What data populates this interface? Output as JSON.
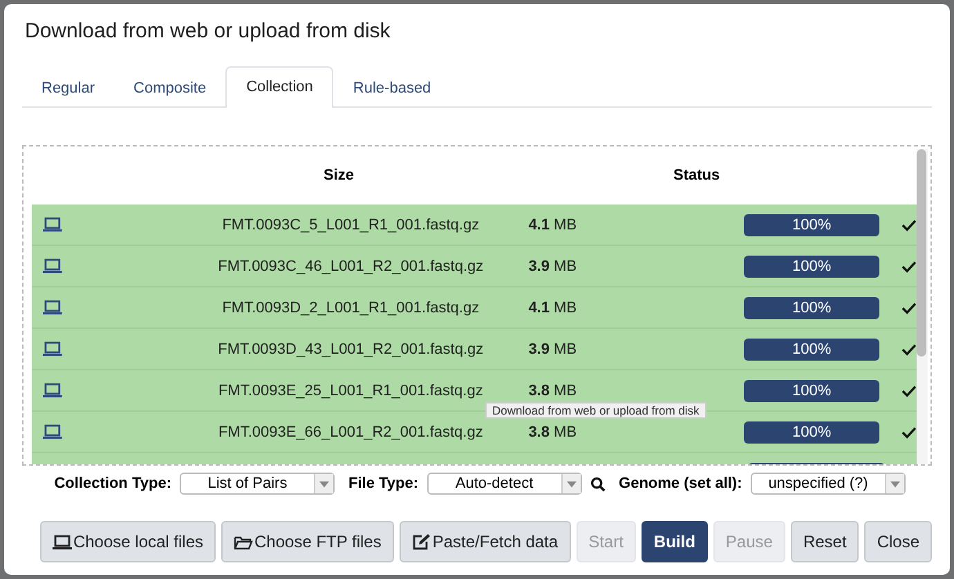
{
  "dialog": {
    "title": "Download from web or upload from disk"
  },
  "tabs": [
    {
      "label": "Regular",
      "selected": false
    },
    {
      "label": "Composite",
      "selected": false
    },
    {
      "label": "Collection",
      "selected": true
    },
    {
      "label": "Rule-based",
      "selected": false
    }
  ],
  "table": {
    "columns": [
      "Size",
      "Status"
    ],
    "rows": [
      {
        "name": "FMT.0093C_5_L001_R1_001.fastq.gz",
        "size": "**4.1** MB",
        "level": 1,
        "progress": "100%",
        "done": true
      },
      {
        "name": "FMT.0093C_46_L001_R2_001.fastq.gz",
        "size": "**3.9** MB",
        "level": 1,
        "progress": "100%",
        "done": true
      },
      {
        "name": "FMT.0093D_2_L001_R1_001.fastq.gz",
        "size": "**4.1** MB",
        "level": 1,
        "progress": "100%",
        "done": true
      },
      {
        "name": "FMT.0093D_43_L001_R2_001.fastq.gz",
        "size": "**3.9** MB",
        "level": 1,
        "progress": "100%",
        "done": true
      },
      {
        "name": "FMT.0093E_25_L001_R1_001.fastq.gz",
        "size": "**3.8** MB",
        "level": 1,
        "progress": "100%",
        "done": true
      },
      {
        "name": "FMT.0093E_66_L001_R2_001.fastq.gz",
        "size": "**3.8** MB",
        "level": 1,
        "progress": "100%",
        "done": true
      }
    ]
  },
  "tooltip": "Download from web or upload from disk",
  "settings": [
    {
      "label": "Collection Type:",
      "value": "List of Pairs",
      "kind": "plain"
    },
    {
      "label": "File Type:",
      "value": "Auto-detect",
      "kind": "search"
    },
    {
      "label": "Genome (set all):",
      "value": "unspecified (?)",
      "kind": "plain"
    }
  ],
  "buttons": [
    {
      "label": "Choose local files",
      "kind": "laptop",
      "disabled": false,
      "primary": false
    },
    {
      "label": "Choose FTP files",
      "kind": "folder",
      "disabled": false,
      "primary": false
    },
    {
      "label": "Paste/Fetch data",
      "kind": "edit",
      "disabled": false,
      "primary": false
    },
    {
      "label": "Start",
      "kind": "text",
      "disabled": true,
      "primary": false
    },
    {
      "label": "Build",
      "kind": "text",
      "disabled": false,
      "primary": true
    },
    {
      "label": "Pause",
      "kind": "text",
      "disabled": true,
      "primary": false
    },
    {
      "label": "Reset",
      "kind": "text",
      "disabled": false,
      "primary": false
    },
    {
      "label": "Close",
      "kind": "text",
      "disabled": false,
      "primary": false
    }
  ]
}
